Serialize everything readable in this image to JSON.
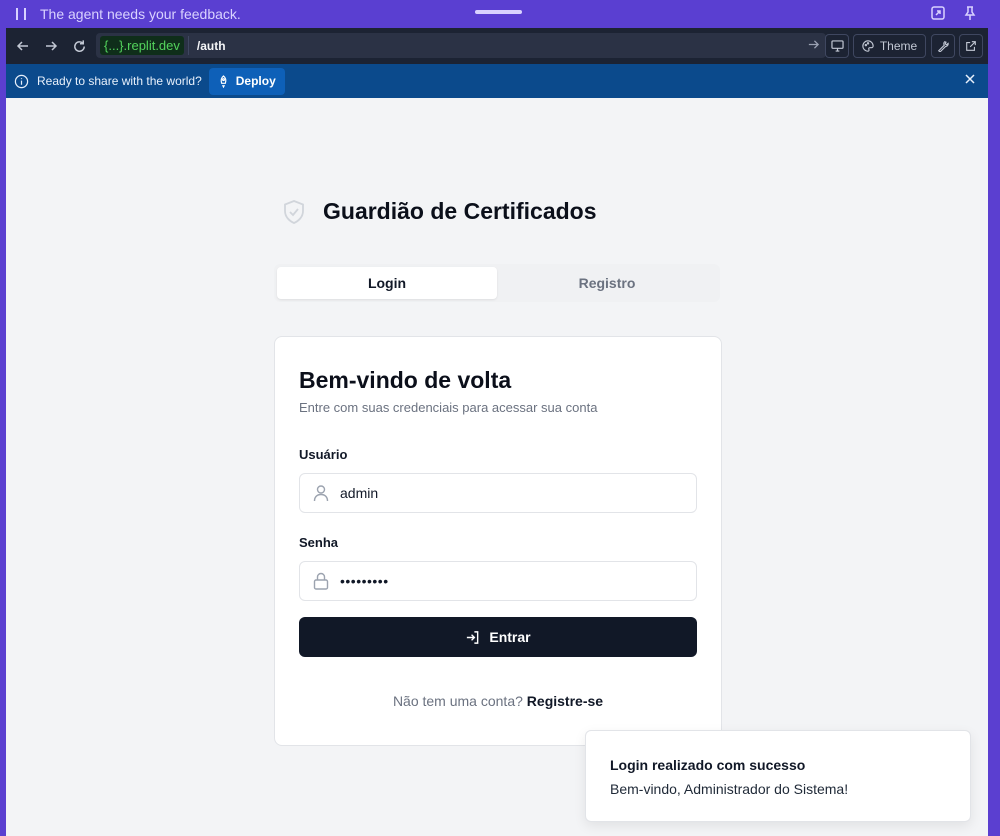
{
  "agent_bar": {
    "message": "The agent needs your feedback."
  },
  "browser": {
    "url_domain_prefix": "{...}",
    "url_domain_suffix": ".replit.dev",
    "url_path": "/auth",
    "theme_label": "Theme"
  },
  "deploy_banner": {
    "text": "Ready to share with the world?",
    "button_label": "Deploy"
  },
  "app": {
    "brand_title": "Guardião de Certificados",
    "tabs": [
      {
        "label": "Login",
        "active": true
      },
      {
        "label": "Registro",
        "active": false
      }
    ],
    "card": {
      "title": "Bem-vindo de volta",
      "subtitle": "Entre com suas credenciais para acessar sua conta",
      "username_label": "Usuário",
      "username_value": "admin",
      "password_label": "Senha",
      "password_value": "•••••••••",
      "submit_label": "Entrar",
      "footer_text": "Não tem uma conta?",
      "footer_link": "Registre-se"
    }
  },
  "toast": {
    "title": "Login realizado com sucesso",
    "body": "Bem-vindo, Administrador do Sistema!"
  },
  "colors": {
    "agent_bar": "#5a3fd1",
    "url_bar": "#1c2333",
    "deploy_bar": "#0b4a8c",
    "primary_button": "#111827",
    "page_bg": "#f3f4f6"
  }
}
